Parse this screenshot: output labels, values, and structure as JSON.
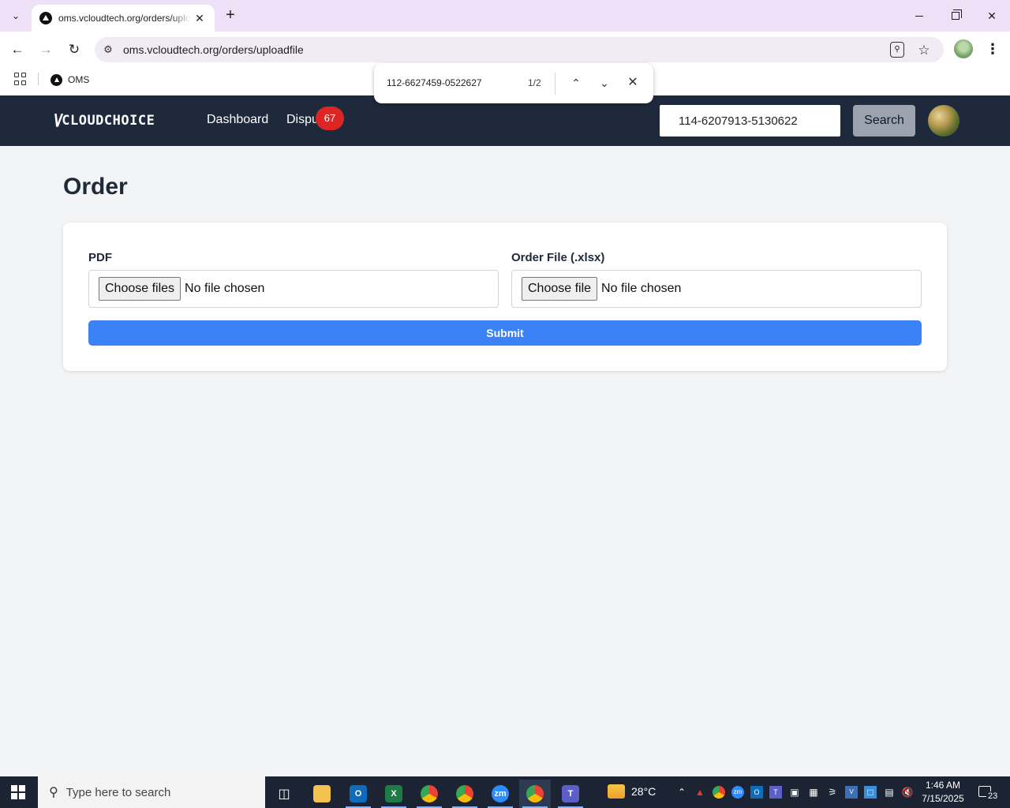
{
  "browser": {
    "tab_title": "oms.vcloudtech.org/orders/uploadfile",
    "url": "oms.vcloudtech.org/orders/uploadfile",
    "bookmarks": [
      {
        "label": "OMS"
      }
    ]
  },
  "findbar": {
    "query": "112-6627459-0522627",
    "count": "1/2"
  },
  "header": {
    "logo_mark": "\\/",
    "logo_text": "CLOUDCHOICE",
    "nav": [
      {
        "label": "Dashboard"
      },
      {
        "label": "Dispu"
      }
    ],
    "disputes_badge": "67",
    "search_value": "114-6207913-5130622",
    "search_button": "Search"
  },
  "page": {
    "title": "Order",
    "pdf_label": "PDF",
    "pdf_button": "Choose files",
    "pdf_status": "No file chosen",
    "order_label": "Order File (.xlsx)",
    "order_button": "Choose file",
    "order_status": "No file chosen",
    "submit": "Submit"
  },
  "taskbar": {
    "search_placeholder": "Type here to search",
    "temperature": "28°C",
    "time": "1:46 AM",
    "date": "7/15/2025",
    "notifications": "23"
  },
  "colors": {
    "header_bg": "#1e293b",
    "submit_bg": "#3b82f6",
    "badge_bg": "#dc2626",
    "page_bg": "#f3f4f6"
  }
}
